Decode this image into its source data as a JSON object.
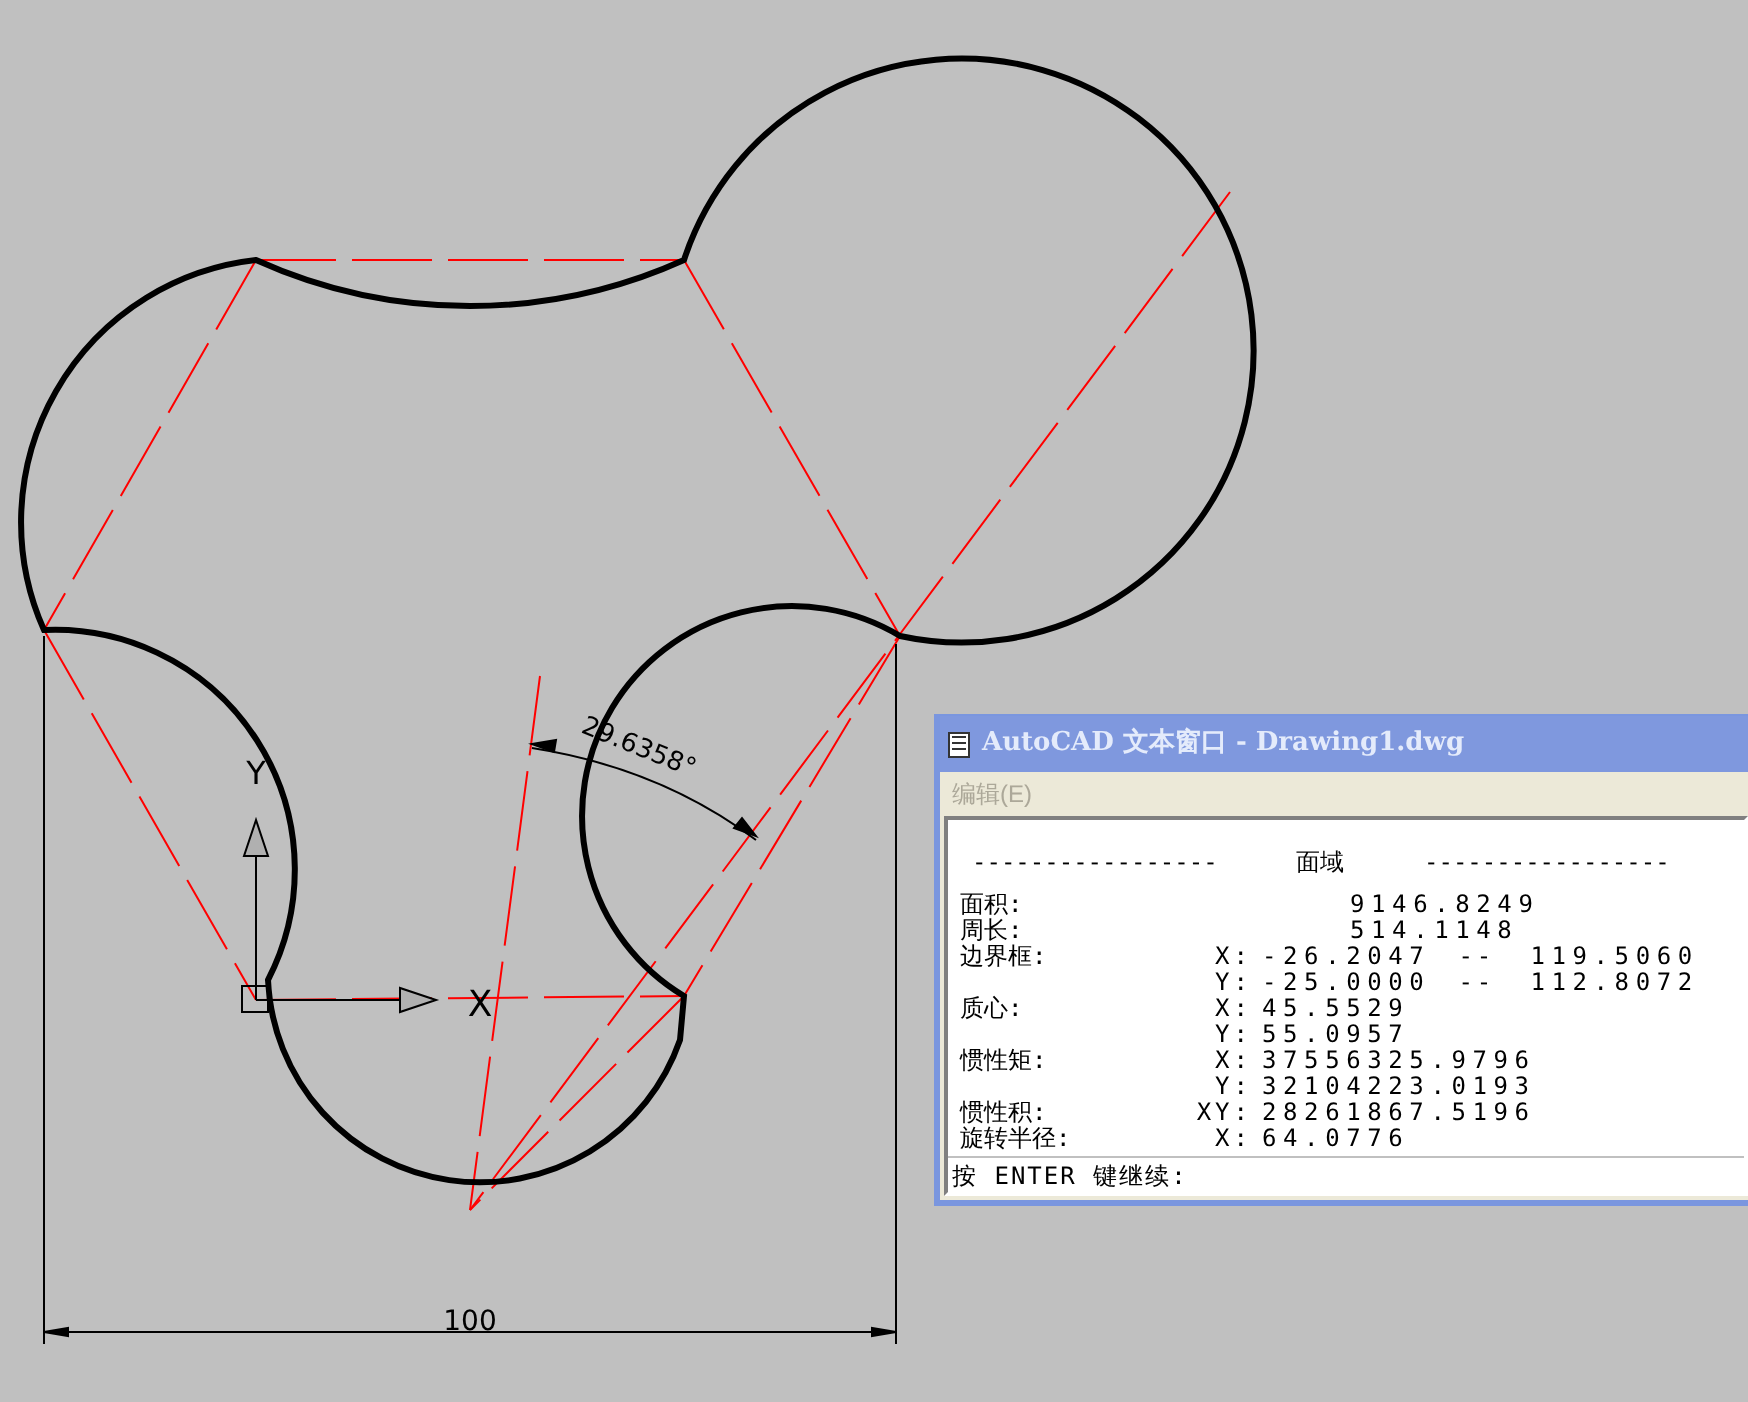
{
  "drawing": {
    "angle_dimension": "29.6358°",
    "linear_dimension": "100",
    "ucs": {
      "x_label": "X",
      "y_label": "Y"
    }
  },
  "text_window": {
    "title": "AutoCAD 文本窗口 - Drawing1.dwg",
    "menu": [
      {
        "label": "编辑(E)",
        "disabled": true
      }
    ],
    "header": {
      "left": "-----------------",
      "title": "面域",
      "right": "-----------------"
    },
    "rows": [
      {
        "label": "面积:",
        "value": "9146.8249"
      },
      {
        "label": "周长:",
        "value": "514.1148"
      },
      {
        "label": "边界框:",
        "axis": "X:",
        "value": "-26.2047",
        "separator": "--",
        "value_end": "119.5060"
      },
      {
        "axis": "Y:",
        "value": "-25.0000",
        "separator": "--",
        "value_end": "112.8072"
      },
      {
        "label": "质心:",
        "axis": "X:",
        "value": "45.5529"
      },
      {
        "axis": "Y:",
        "value": "55.0957"
      },
      {
        "label": "惯性矩:",
        "axis": "X:",
        "value": "37556325.9796"
      },
      {
        "axis": "Y:",
        "value": "32104223.0193"
      },
      {
        "label": "惯性积:",
        "axis": "XY:",
        "value": "28261867.5196"
      },
      {
        "label": "旋转半径:",
        "axis": "X:",
        "value": "64.0776"
      }
    ],
    "prompt": "按 ENTER 键继续:"
  }
}
